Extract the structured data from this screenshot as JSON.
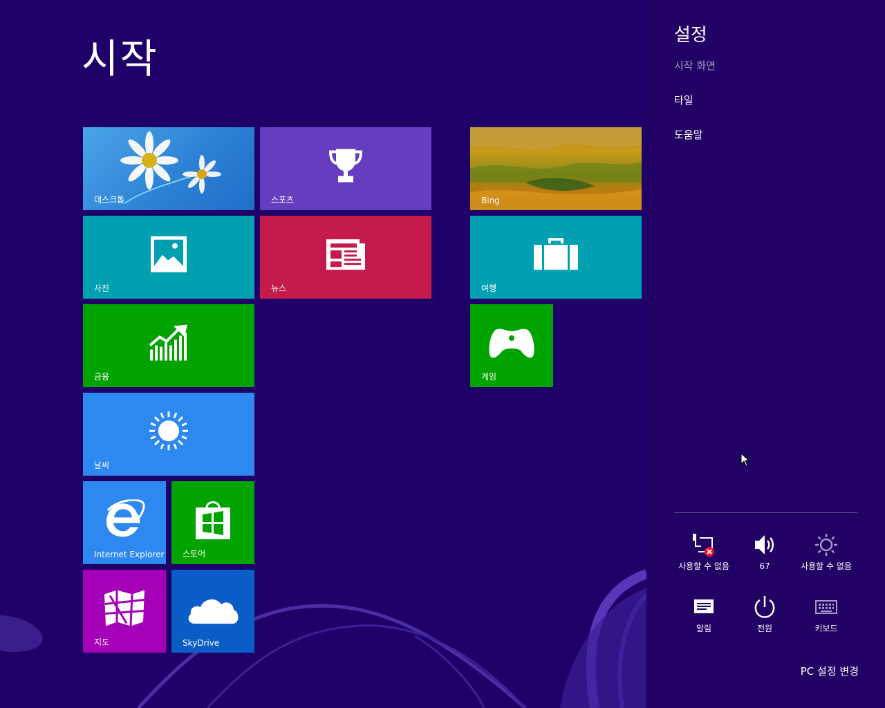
{
  "start": {
    "title": "시작",
    "tiles": [
      {
        "id": "desktop",
        "label": "데스크톱"
      },
      {
        "id": "sports",
        "label": "스포츠"
      },
      {
        "id": "bing",
        "label": "Bing"
      },
      {
        "id": "photos",
        "label": "사진"
      },
      {
        "id": "news",
        "label": "뉴스"
      },
      {
        "id": "travel",
        "label": "여행"
      },
      {
        "id": "finance",
        "label": "금융"
      },
      {
        "id": "games",
        "label": "게임"
      },
      {
        "id": "weather",
        "label": "날씨"
      },
      {
        "id": "ie",
        "label": "Internet Explorer"
      },
      {
        "id": "store",
        "label": "스토어"
      },
      {
        "id": "maps",
        "label": "지도"
      },
      {
        "id": "skydrive",
        "label": "SkyDrive"
      }
    ]
  },
  "charm": {
    "title": "설정",
    "subtitle": "시작 화면",
    "links": [
      "타일",
      "도움말"
    ],
    "quick_settings": [
      {
        "icon": "network-unavailable-icon",
        "label": "사용할 수 없음"
      },
      {
        "icon": "volume-icon",
        "label": "67"
      },
      {
        "icon": "brightness-icon",
        "label": "사용할 수 없음"
      },
      {
        "icon": "notifications-icon",
        "label": "알림"
      },
      {
        "icon": "power-icon",
        "label": "전원"
      },
      {
        "icon": "keyboard-icon",
        "label": "키보드"
      }
    ],
    "pc_settings": "PC 설정 변경"
  },
  "colors": {
    "background": "#1f0068",
    "charm": "#220164",
    "teal": "#00a0b1",
    "green": "#00a300",
    "purple": "#643ebf",
    "crimson": "#c41a4c",
    "blue": "#2d89ef",
    "magenta": "#a400b8",
    "dark_blue": "#0a5cc6"
  }
}
